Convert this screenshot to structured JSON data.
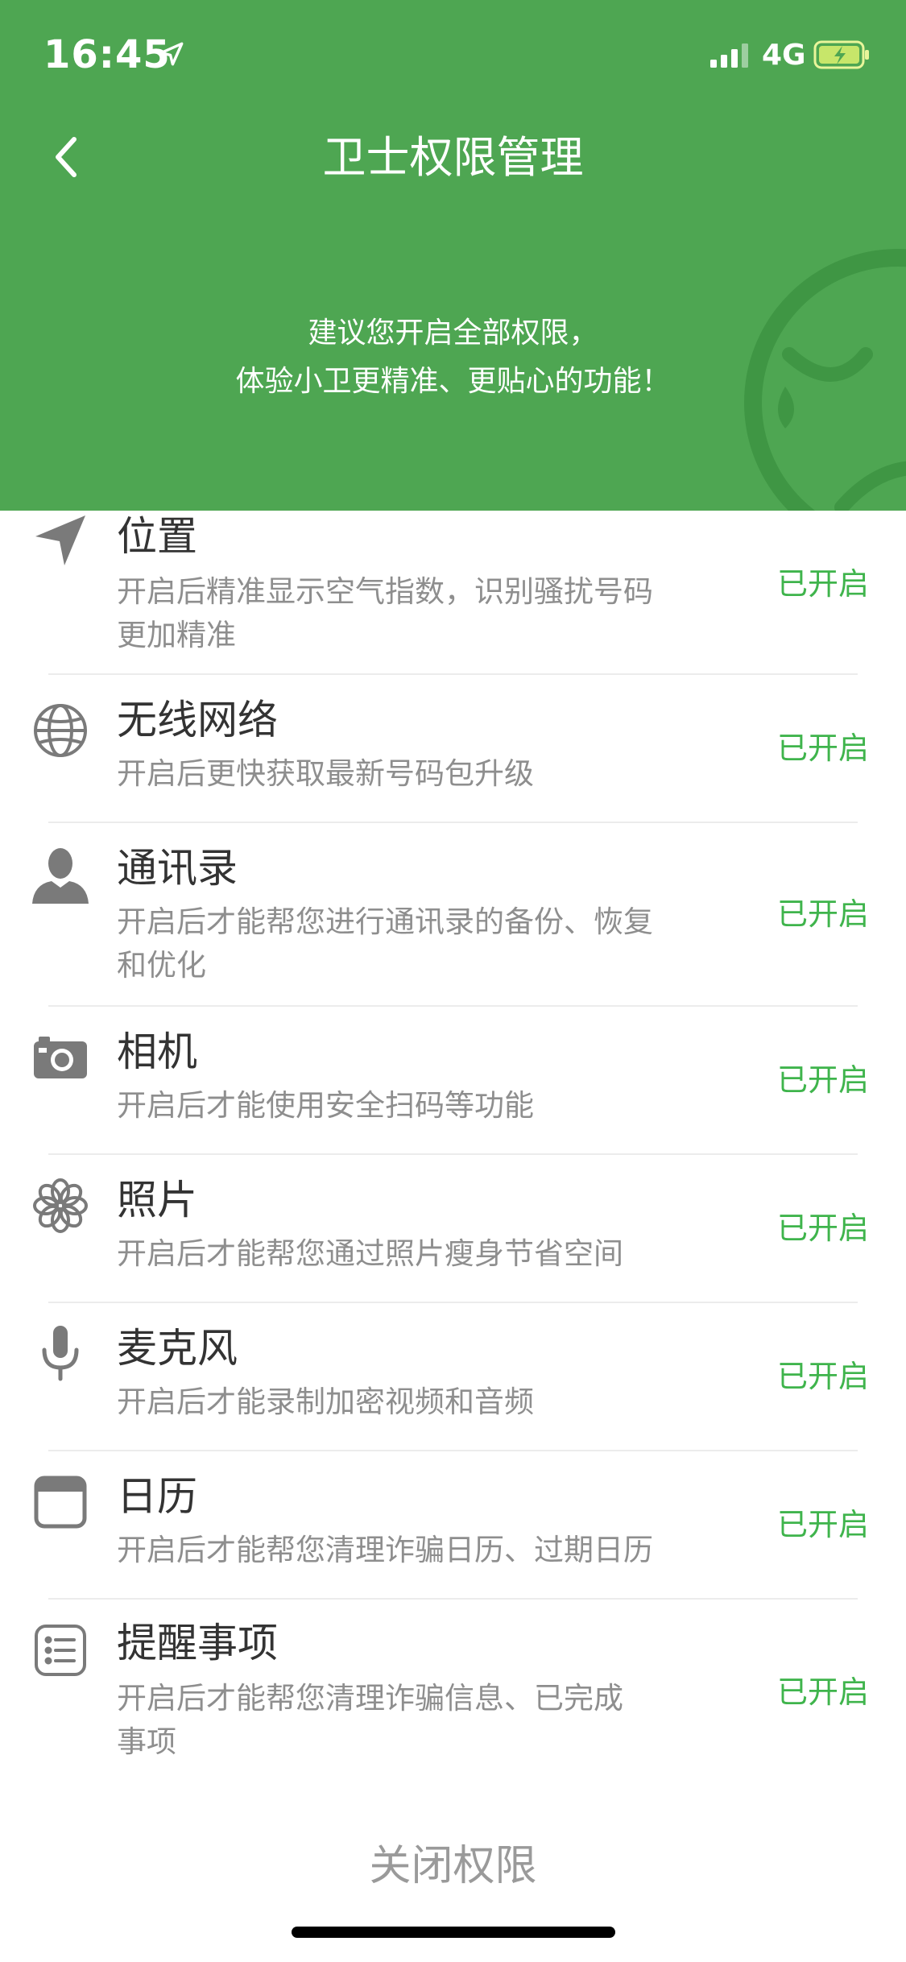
{
  "status_bar": {
    "time": "16:45",
    "network": "4G",
    "icons": [
      "location-arrow-icon",
      "signal-icon",
      "battery-charging-icon"
    ]
  },
  "header": {
    "back_icon": "chevron-left-icon",
    "title": "卫士权限管理",
    "subtitle_line1": "建议您开启全部权限，",
    "subtitle_line2": "体验小卫更精准、更贴心的功能！",
    "bg_color": "#4ea652"
  },
  "permissions": [
    {
      "icon": "location-arrow-icon",
      "title": "位置",
      "desc_line1": "开启后精准显示空气指数，识别骚扰号码",
      "desc_line2": "更加精准",
      "status": "已开启"
    },
    {
      "icon": "globe-icon",
      "title": "无线网络",
      "desc_line1": "开启后更快获取最新号码包升级",
      "desc_line2": "",
      "status": "已开启"
    },
    {
      "icon": "contact-person-icon",
      "title": "通讯录",
      "desc_line1": "开启后才能帮您进行通讯录的备份、恢复",
      "desc_line2": "和优化",
      "status": "已开启"
    },
    {
      "icon": "camera-icon",
      "title": "相机",
      "desc_line1": "开启后才能使用安全扫码等功能",
      "desc_line2": "",
      "status": "已开启"
    },
    {
      "icon": "photos-flower-icon",
      "title": "照片",
      "desc_line1": "开启后才能帮您通过照片瘦身节省空间",
      "desc_line2": "",
      "status": "已开启"
    },
    {
      "icon": "microphone-icon",
      "title": "麦克风",
      "desc_line1": "开启后才能录制加密视频和音频",
      "desc_line2": "",
      "status": "已开启"
    },
    {
      "icon": "calendar-icon",
      "title": "日历",
      "desc_line1": "开启后才能帮您清理诈骗日历、过期日历",
      "desc_line2": "",
      "status": "已开启"
    },
    {
      "icon": "reminders-list-icon",
      "title": "提醒事项",
      "desc_line1": "开启后才能帮您清理诈骗信息、已完成",
      "desc_line2": "事项",
      "status": "已开启"
    }
  ],
  "footer": {
    "close_label": "关闭权限"
  },
  "colors": {
    "accent_green": "#3fb44c",
    "header_green": "#4ea652",
    "title_text": "#333333",
    "desc_text": "#8e8e8e"
  }
}
